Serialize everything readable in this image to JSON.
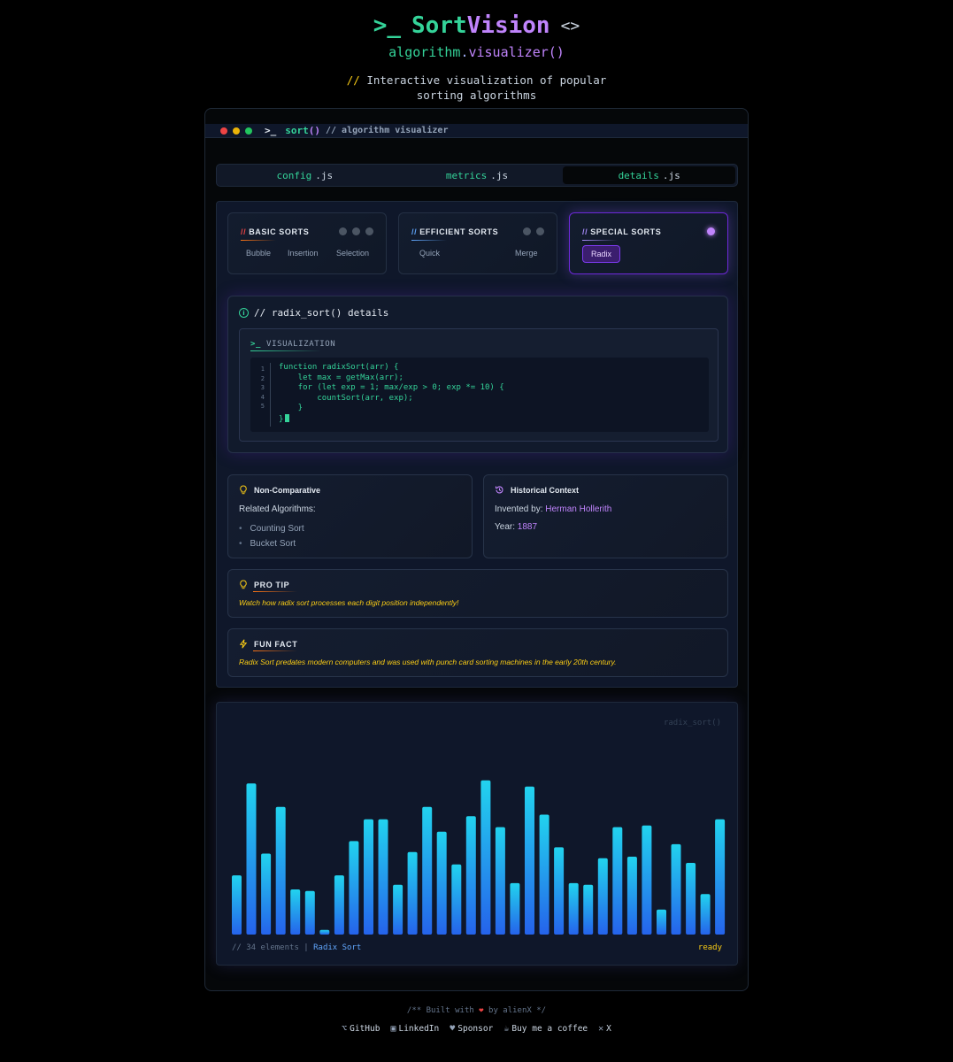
{
  "header": {
    "prompt": ">_",
    "title_a": "Sort",
    "title_b": "Vision",
    "code_icon": "<>",
    "sub_a": "algorithm",
    "sub_dot": ".",
    "sub_b": "visualizer",
    "sub_c": "()",
    "desc_slash": "//",
    "desc_line1": "Interactive visualization of popular",
    "desc_line2": "sorting algorithms"
  },
  "window": {
    "prompt": ">_",
    "fn": "sort",
    "paren": "()",
    "comment": "// algorithm visualizer"
  },
  "tabs": [
    {
      "name": "config",
      "ext": ".js"
    },
    {
      "name": "metrics",
      "ext": ".js"
    },
    {
      "name": "details",
      "ext": ".js"
    }
  ],
  "categories": {
    "basic": {
      "slash": "//",
      "title": "BASIC SORTS",
      "items": [
        "Bubble",
        "Insertion",
        "Selection"
      ]
    },
    "efficient": {
      "slash": "//",
      "title": "EFFICIENT SORTS",
      "items": [
        "Quick",
        "Merge"
      ]
    },
    "special": {
      "slash": "//",
      "title": "SPECIAL SORTS",
      "items": [
        "Radix"
      ]
    }
  },
  "details": {
    "title": "// radix_sort() details",
    "viz_prompt": ">_",
    "viz_title": "VISUALIZATION",
    "line_numbers": [
      "1",
      "2",
      "3",
      "4",
      "5"
    ],
    "code": "function radixSort(arr) {\n    let max = getMax(arr);\n    for (let exp = 1; max/exp > 0; exp *= 10) {\n        countSort(arr, exp);\n    }\n}"
  },
  "cards": {
    "noncomp": {
      "title": "Non-Comparative",
      "label": "Related Algorithms:",
      "items": [
        "Counting Sort",
        "Bucket Sort"
      ]
    },
    "history": {
      "title": "Historical Context",
      "inventor_label": "Invented by:",
      "inventor": "Herman Hollerith",
      "year_label": "Year:",
      "year": "1887"
    },
    "tip": {
      "title": "PRO TIP",
      "text": "Watch how radix sort processes each digit position independently!"
    },
    "fact": {
      "title": "FUN FACT",
      "text": "Radix Sort predates modern computers and was used with punch card sorting machines in the early 20th century."
    }
  },
  "chart": {
    "label": "radix_sort()",
    "footer_count": "// 34 elements |",
    "footer_algo": "Radix Sort",
    "status": "ready"
  },
  "chart_data": {
    "type": "bar",
    "values": [
      38,
      97,
      52,
      82,
      29,
      28,
      3,
      38,
      60,
      74,
      74,
      32,
      53,
      82,
      66,
      45,
      76,
      99,
      69,
      33,
      95,
      77,
      56,
      33,
      32,
      49,
      69,
      50,
      70,
      16,
      58,
      46,
      26,
      74
    ],
    "ylim": [
      0,
      100
    ],
    "colors": {
      "top": "#22d3ee",
      "bottom": "#2563eb"
    }
  },
  "footer": {
    "built_pre": "/** Built with",
    "heart": "❤",
    "built_post": "by alienX */",
    "links": [
      "GitHub",
      "LinkedIn",
      "Sponsor",
      "Buy me a coffee",
      "X"
    ]
  }
}
